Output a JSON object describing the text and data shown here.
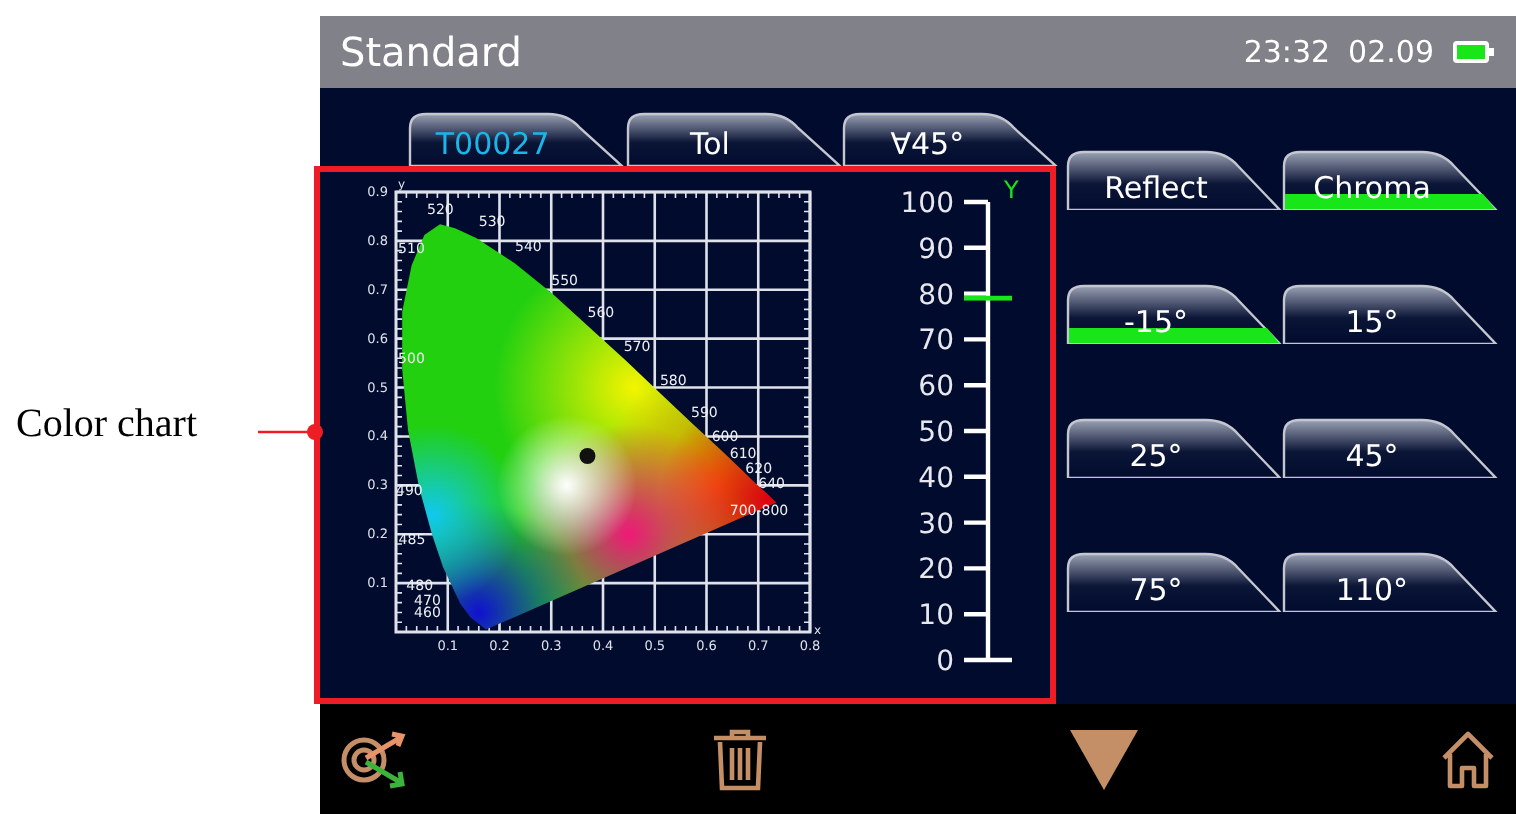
{
  "callout": {
    "label": "Color chart"
  },
  "header": {
    "title": "Standard",
    "time": "23:32",
    "date": "02.09"
  },
  "tabs": [
    {
      "label": "T00027",
      "selected": true
    },
    {
      "label": "Tol",
      "selected": false
    },
    {
      "label": "∀45°",
      "selected": false
    }
  ],
  "color_chart": {
    "chart_data": {
      "type": "scatter",
      "xlabel": "x",
      "ylabel": "y",
      "x": [
        0.37
      ],
      "values": [
        0.36
      ],
      "xlim": [
        0,
        0.8
      ],
      "ylim": [
        0,
        0.9
      ],
      "xticks": [
        0.1,
        0.2,
        0.3,
        0.4,
        0.5,
        0.6,
        0.7,
        0.8
      ],
      "yticks": [
        0.1,
        0.2,
        0.3,
        0.4,
        0.5,
        0.6,
        0.7,
        0.8,
        0.9
      ],
      "grid": true,
      "annotations": [
        "520",
        "530",
        "540",
        "550",
        "560",
        "570",
        "580",
        "590",
        "600",
        "610",
        "620",
        "640",
        "700-800",
        "510",
        "500",
        "490",
        "485",
        "480",
        "470",
        "460"
      ]
    }
  },
  "y_scale": {
    "label": "Y",
    "ticks": [
      "100",
      "90",
      "80",
      "70",
      "60",
      "50",
      "40",
      "30",
      "20",
      "10",
      "0"
    ],
    "level": 0.79
  },
  "mode_buttons": [
    {
      "label": "Reflect",
      "selected": false
    },
    {
      "label": "Chroma",
      "selected": true
    }
  ],
  "angle_buttons": [
    {
      "label": "-15°",
      "selected": true
    },
    {
      "label": "15°",
      "selected": false
    },
    {
      "label": "25°",
      "selected": false
    },
    {
      "label": "45°",
      "selected": false
    },
    {
      "label": "75°",
      "selected": false
    },
    {
      "label": "110°",
      "selected": false
    }
  ]
}
